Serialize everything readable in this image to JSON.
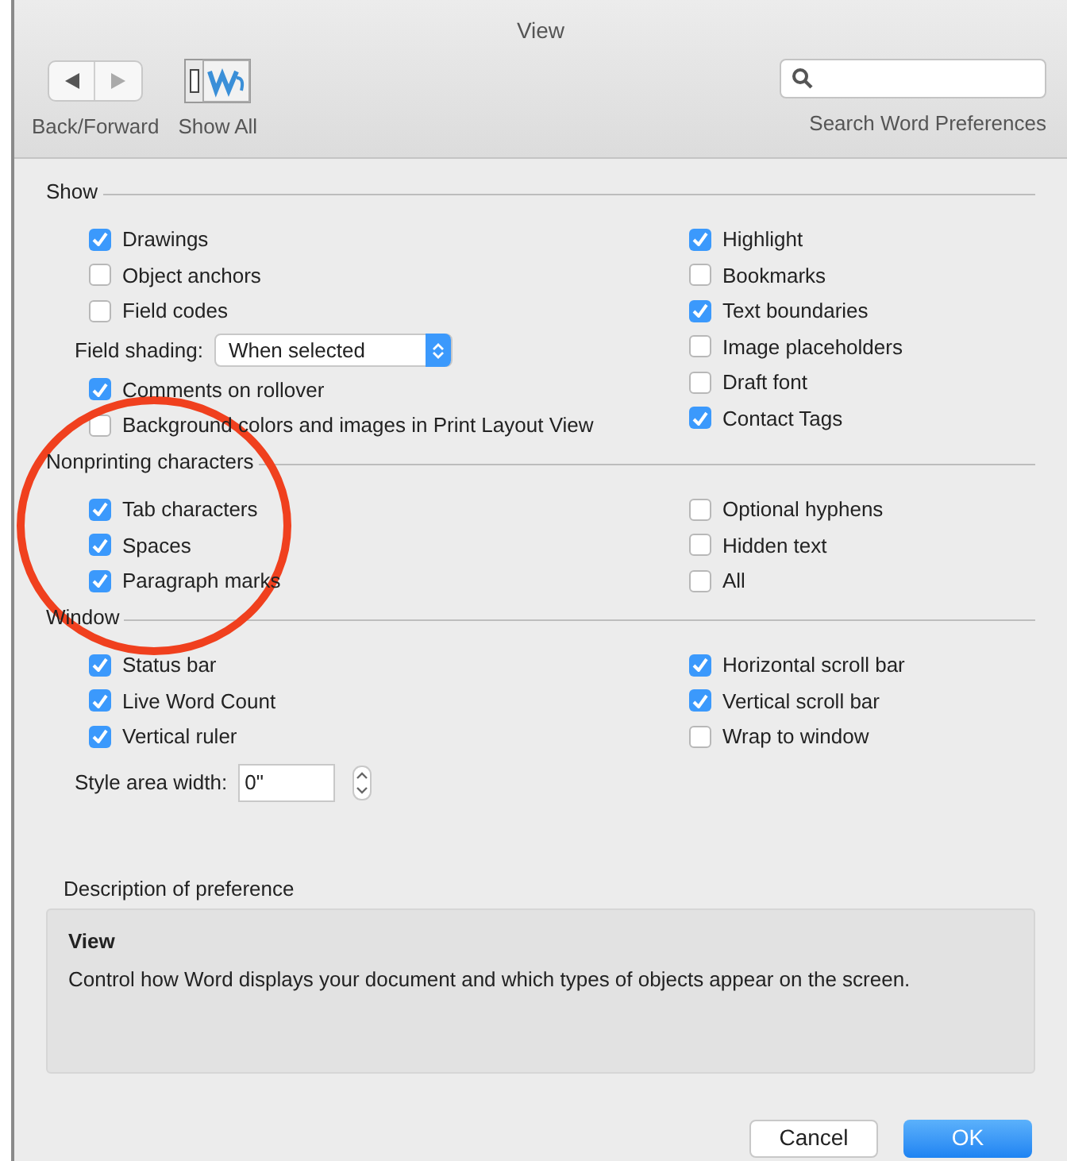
{
  "window": {
    "title": "View"
  },
  "toolbar": {
    "nav_label": "Back/Forward",
    "show_all_label": "Show All",
    "search_label": "Search Word Preferences"
  },
  "sections": [
    {
      "title": "Show",
      "left": [
        {
          "kind": "checkbox",
          "label": "Drawings",
          "checked": true
        },
        {
          "kind": "checkbox",
          "label": "Object anchors",
          "checked": false
        },
        {
          "kind": "checkbox",
          "label": "Field codes",
          "checked": false
        },
        {
          "kind": "popup",
          "label": "Field shading:",
          "value": "When selected"
        },
        {
          "kind": "checkbox",
          "label": "Comments on rollover",
          "checked": true
        },
        {
          "kind": "checkbox",
          "label": "Background colors and images in Print Layout View",
          "checked": false
        }
      ],
      "right": [
        {
          "kind": "checkbox",
          "label": "Highlight",
          "checked": true
        },
        {
          "kind": "checkbox",
          "label": "Bookmarks",
          "checked": false
        },
        {
          "kind": "checkbox",
          "label": "Text boundaries",
          "checked": true
        },
        {
          "kind": "checkbox",
          "label": "Image placeholders",
          "checked": false
        },
        {
          "kind": "checkbox",
          "label": "Draft font",
          "checked": false
        },
        {
          "kind": "checkbox",
          "label": "Contact Tags",
          "checked": true
        }
      ]
    },
    {
      "title": "Nonprinting characters",
      "left": [
        {
          "kind": "checkbox",
          "label": "Tab characters",
          "checked": true
        },
        {
          "kind": "checkbox",
          "label": "Spaces",
          "checked": true
        },
        {
          "kind": "checkbox",
          "label": "Paragraph marks",
          "checked": true
        }
      ],
      "right": [
        {
          "kind": "checkbox",
          "label": "Optional hyphens",
          "checked": false
        },
        {
          "kind": "checkbox",
          "label": "Hidden text",
          "checked": false
        },
        {
          "kind": "checkbox",
          "label": "All",
          "checked": false
        }
      ]
    },
    {
      "title": "Window",
      "left": [
        {
          "kind": "checkbox",
          "label": "Status bar",
          "checked": true
        },
        {
          "kind": "checkbox",
          "label": "Live Word Count",
          "checked": true
        },
        {
          "kind": "checkbox",
          "label": "Vertical ruler",
          "checked": true
        },
        {
          "kind": "stepper",
          "label": "Style area width:",
          "value": "0\""
        }
      ],
      "right": [
        {
          "kind": "checkbox",
          "label": "Horizontal scroll bar",
          "checked": true
        },
        {
          "kind": "checkbox",
          "label": "Vertical scroll bar",
          "checked": true
        },
        {
          "kind": "checkbox",
          "label": "Wrap to window",
          "checked": false
        }
      ]
    }
  ],
  "description": {
    "label": "Description of preference",
    "heading": "View",
    "text": "Control how Word displays your document and which types of objects appear on the screen."
  },
  "buttons": [
    {
      "label": "Cancel",
      "default": false
    },
    {
      "label": "OK",
      "default": true
    }
  ]
}
